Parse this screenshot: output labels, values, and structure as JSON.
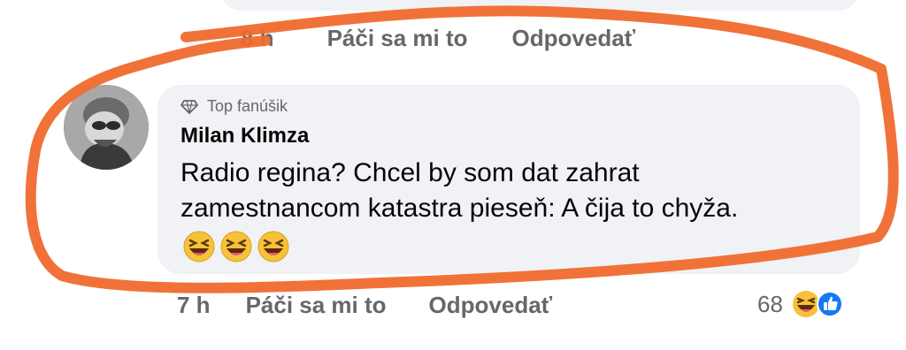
{
  "previous_comment": {
    "time": "8 h",
    "like_label": "Páči sa mi to",
    "reply_label": "Odpovedať"
  },
  "comment": {
    "badge": "Top fanúšik",
    "badge_icon": "diamond-icon",
    "author": "Milan Klimza",
    "text_line1": "Radio regina? Chcel by som dat zahrat",
    "text_line2": "zamestnancom katastra pieseň: A čija to chyža.",
    "emojis": [
      "laughing-emoji",
      "laughing-emoji",
      "laughing-emoji"
    ],
    "time": "7 h",
    "like_label": "Páči sa mi to",
    "reply_label": "Odpovedať",
    "reaction_count": "68",
    "reaction_icons": [
      "haha-reaction-icon",
      "like-reaction-icon"
    ]
  },
  "colors": {
    "bubble": "#f0f2f5",
    "secondary_text": "#65676b",
    "annotation_stroke": "#f06a2e",
    "like_blue": "#1877f2",
    "emoji_yellow": "#f7c23a"
  }
}
